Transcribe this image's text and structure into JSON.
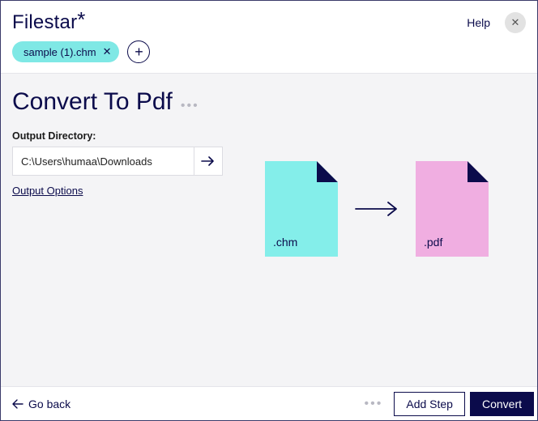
{
  "header": {
    "app_name": "Filestar",
    "help_label": "Help"
  },
  "chips": {
    "file_name": "sample (1).chm"
  },
  "main": {
    "title": "Convert To Pdf",
    "output_label": "Output Directory:",
    "output_path": "C:\\Users\\humaa\\Downloads",
    "options_link": "Output Options"
  },
  "illustration": {
    "src_ext": ".chm",
    "dst_ext": ".pdf"
  },
  "footer": {
    "back_label": "Go back",
    "add_step_label": "Add Step",
    "convert_label": "Convert"
  }
}
